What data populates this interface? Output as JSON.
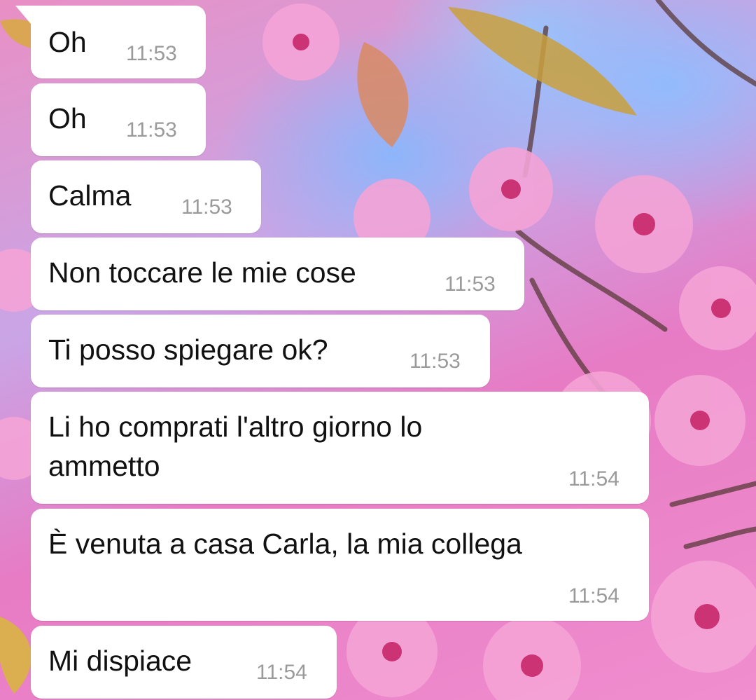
{
  "conversation": {
    "messages": [
      {
        "text": "Oh",
        "time": "11:53"
      },
      {
        "text": "Oh",
        "time": "11:53"
      },
      {
        "text": "Calma",
        "time": "11:53"
      },
      {
        "text": "Non toccare le mie cose",
        "time": "11:53"
      },
      {
        "text": "Ti posso spiegare ok?",
        "time": "11:53"
      },
      {
        "text_line1": "Li ho comprati l'altro giorno lo",
        "text_line2": "ammetto",
        "time": "11:54"
      },
      {
        "text": "È venuta a casa Carla, la mia collega",
        "time": "11:54"
      },
      {
        "text": "Mi dispiace",
        "time": "11:54"
      }
    ]
  },
  "theme": {
    "bubble_color": "#ffffff",
    "text_color": "#111111",
    "time_color": "#9a9a9a",
    "wallpaper_accent": "#e87ac6"
  }
}
